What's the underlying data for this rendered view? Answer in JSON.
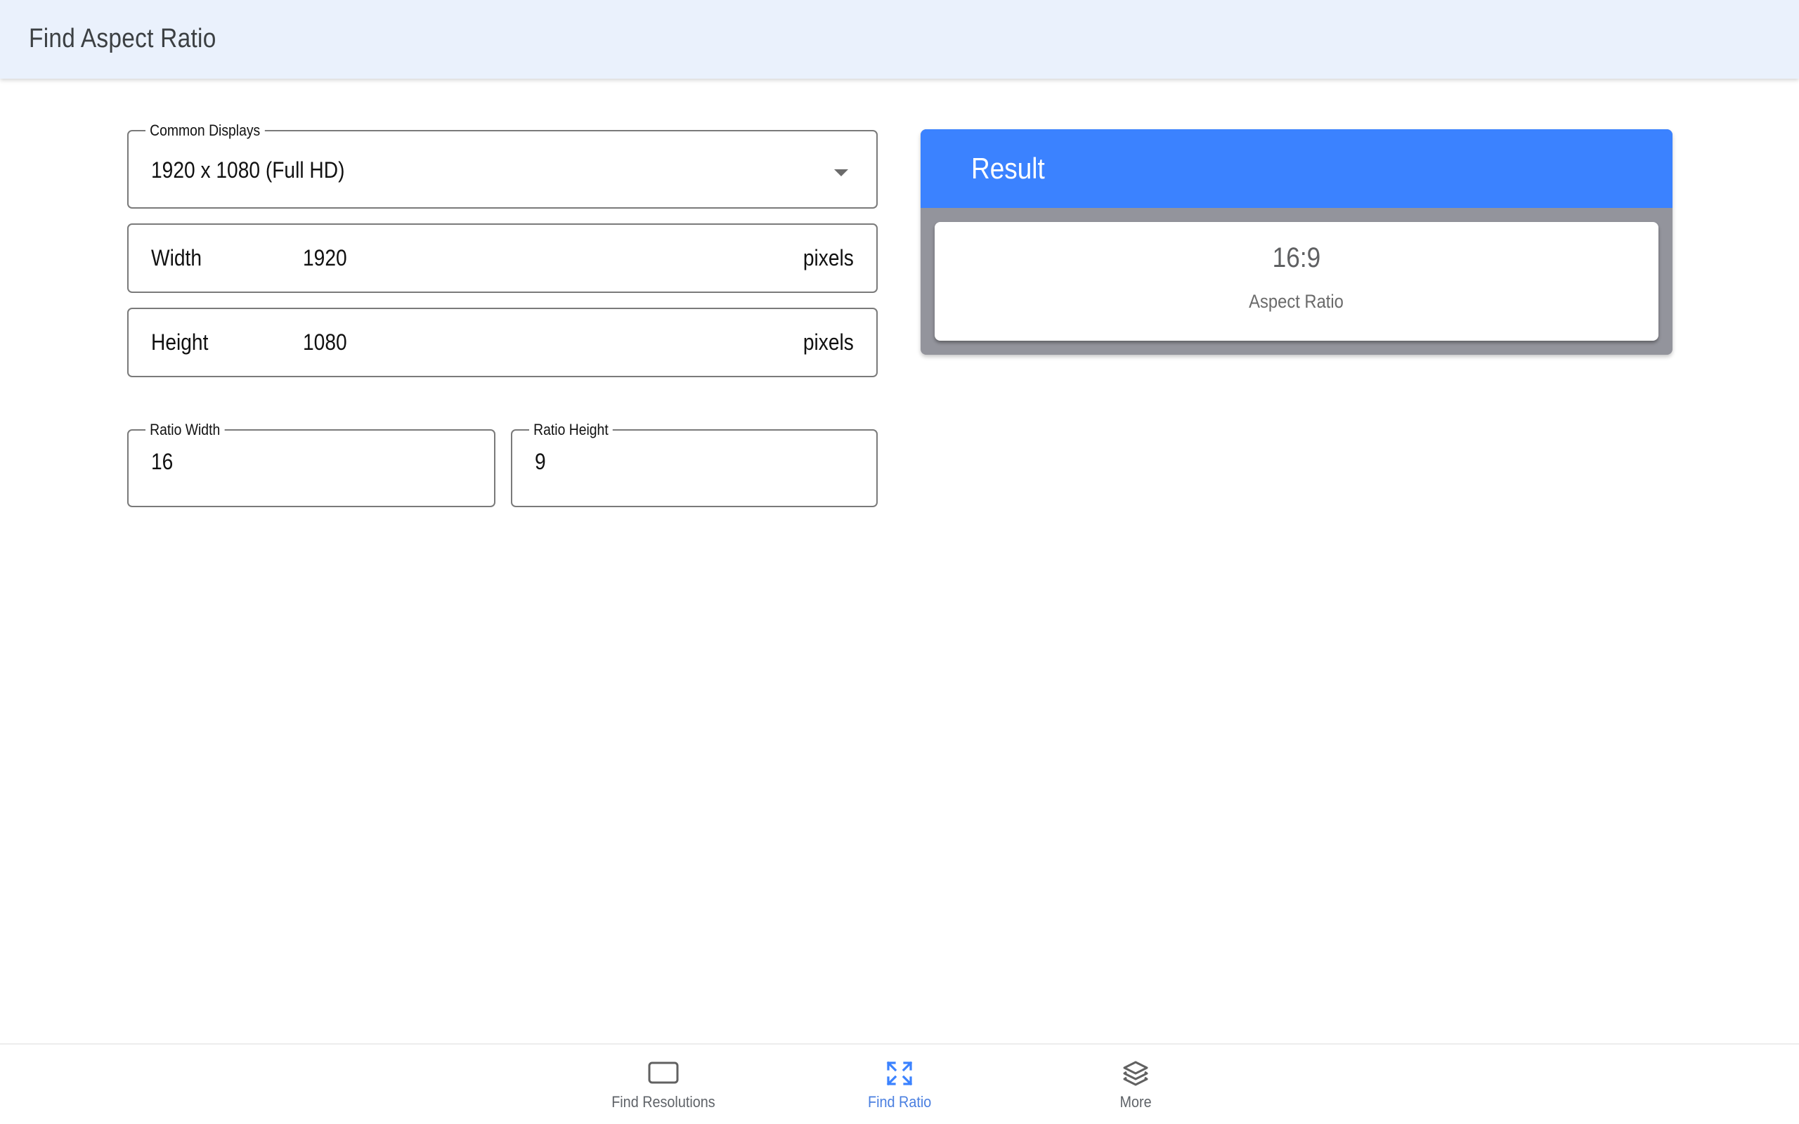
{
  "header": {
    "title": "Find Aspect Ratio"
  },
  "form": {
    "common_displays": {
      "label": "Common Displays",
      "selected": "1920 x 1080 (Full HD)",
      "icon": "arrow-drop-down-icon"
    },
    "width": {
      "label": "Width",
      "value": "1920",
      "unit": "pixels"
    },
    "height": {
      "label": "Height",
      "value": "1080",
      "unit": "pixels"
    },
    "ratio_width": {
      "label": "Ratio Width",
      "value": "16"
    },
    "ratio_height": {
      "label": "Ratio Height",
      "value": "9"
    }
  },
  "result": {
    "title": "Result",
    "value": "16:9",
    "caption": "Aspect Ratio"
  },
  "bottom_nav": {
    "items": [
      {
        "label": "Find Resolutions",
        "icon": "rectangle-icon",
        "active": false
      },
      {
        "label": "Find Ratio",
        "icon": "expand-arrows-icon",
        "active": true
      },
      {
        "label": "More",
        "icon": "layers-icon",
        "active": false
      }
    ]
  },
  "colors": {
    "header_bg": "#eaf1fc",
    "accent_blue": "#3b82ff",
    "active_nav": "#4a7fe0",
    "result_body": "#93949c"
  }
}
